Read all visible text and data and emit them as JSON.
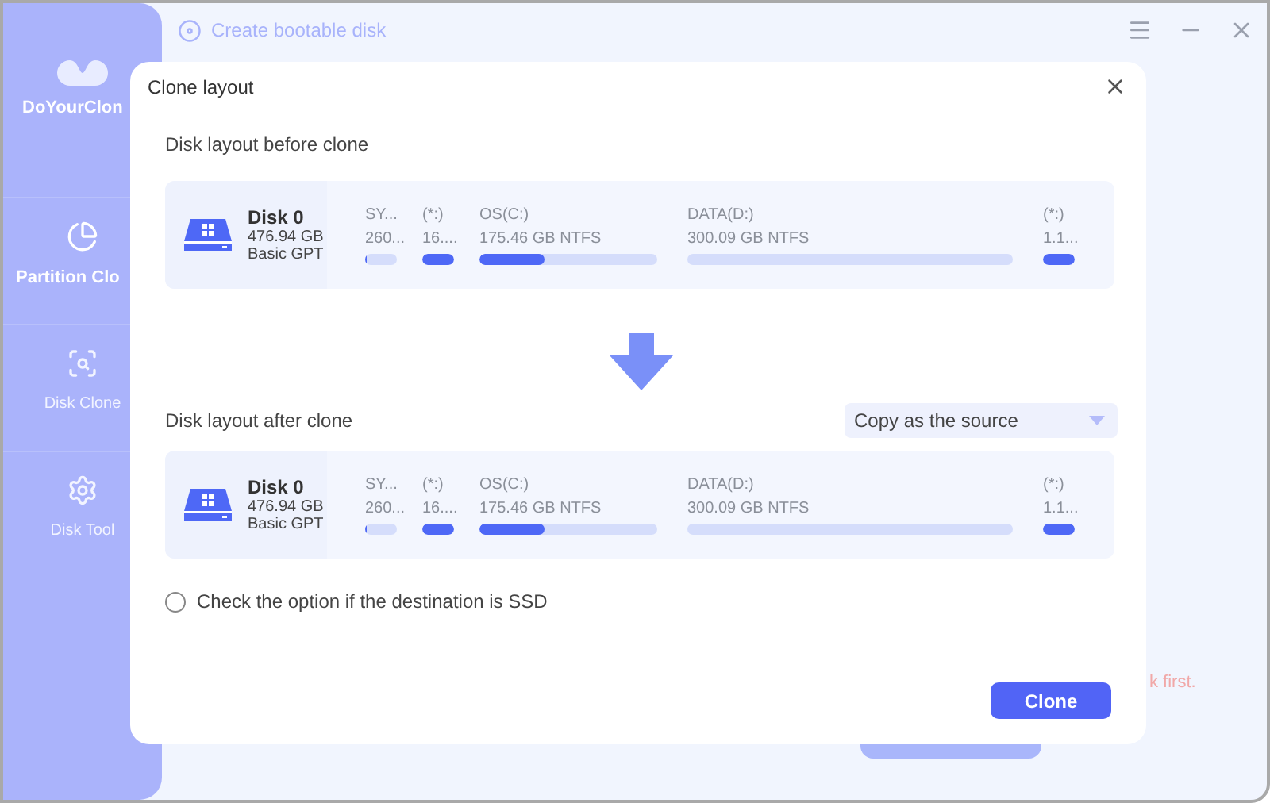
{
  "app": {
    "name": "DoYourClon",
    "title_action": "Create bootable disk",
    "background_hint": "k first.",
    "nav": [
      {
        "label": "Partition Clo",
        "kind": "partition",
        "selected": true
      },
      {
        "label": "Disk Clone",
        "kind": "disk",
        "selected": false
      },
      {
        "label": "Disk Tool",
        "kind": "tool",
        "selected": false
      }
    ]
  },
  "dialog": {
    "title": "Clone layout",
    "before": {
      "heading": "Disk layout before clone",
      "disk": {
        "name": "Disk 0",
        "size": "476.94 GB",
        "type": "Basic GPT",
        "partitions": [
          {
            "name": "SY...",
            "size": "260...",
            "level": 0.05
          },
          {
            "name": "(*:)",
            "size": "16....",
            "level": 1
          },
          {
            "name": "OS(C:)",
            "size": "175.46 GB NTFS",
            "level": 0.37
          },
          {
            "name": "DATA(D:)",
            "size": "300.09 GB NTFS",
            "level": 0
          },
          {
            "name": "(*:)",
            "size": "1.1...",
            "level": 1
          }
        ]
      }
    },
    "after": {
      "heading": "Disk layout after clone",
      "mode": "Copy as the source",
      "disk": {
        "name": "Disk 0",
        "size": "476.94 GB",
        "type": "Basic GPT",
        "partitions": [
          {
            "name": "SY...",
            "size": "260...",
            "level": 0.05
          },
          {
            "name": "(*:)",
            "size": "16....",
            "level": 1
          },
          {
            "name": "OS(C:)",
            "size": "175.46 GB NTFS",
            "level": 0.37
          },
          {
            "name": "DATA(D:)",
            "size": "300.09 GB NTFS",
            "level": 0
          },
          {
            "name": "(*:)",
            "size": "1.1...",
            "level": 1
          }
        ]
      }
    },
    "ssd_option": {
      "label": "Check the option if the destination is SSD",
      "checked": false
    },
    "button": "Clone"
  }
}
